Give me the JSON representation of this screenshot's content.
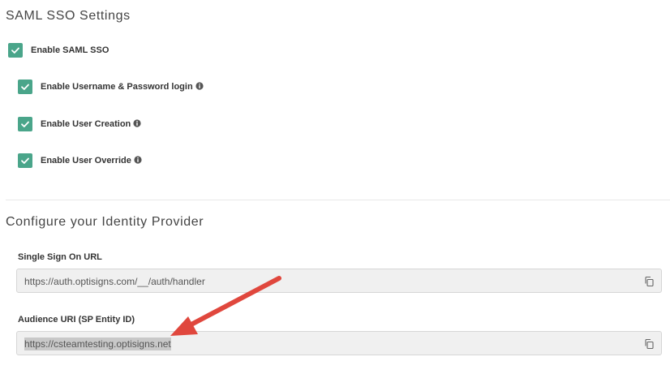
{
  "saml": {
    "title": "SAML SSO Settings",
    "enable_label": "Enable SAML SSO",
    "options": [
      {
        "label": "Enable Username & Password login",
        "checked": true
      },
      {
        "label": "Enable User Creation",
        "checked": true
      },
      {
        "label": "Enable User Override",
        "checked": true
      }
    ]
  },
  "idp": {
    "title": "Configure your Identity Provider",
    "sso_url_label": "Single Sign On URL",
    "sso_url_value": "https://auth.optisigns.com/__/auth/handler",
    "audience_label": "Audience URI (SP Entity ID)",
    "audience_value": "https://csteamtesting.optisigns.net"
  },
  "colors": {
    "checkbox": "#4aa58a",
    "arrow": "#e0473d",
    "field_bg": "#f0f0f0"
  },
  "icons": [
    "check-icon",
    "info-icon",
    "copy-icon",
    "arrow-annotation"
  ]
}
